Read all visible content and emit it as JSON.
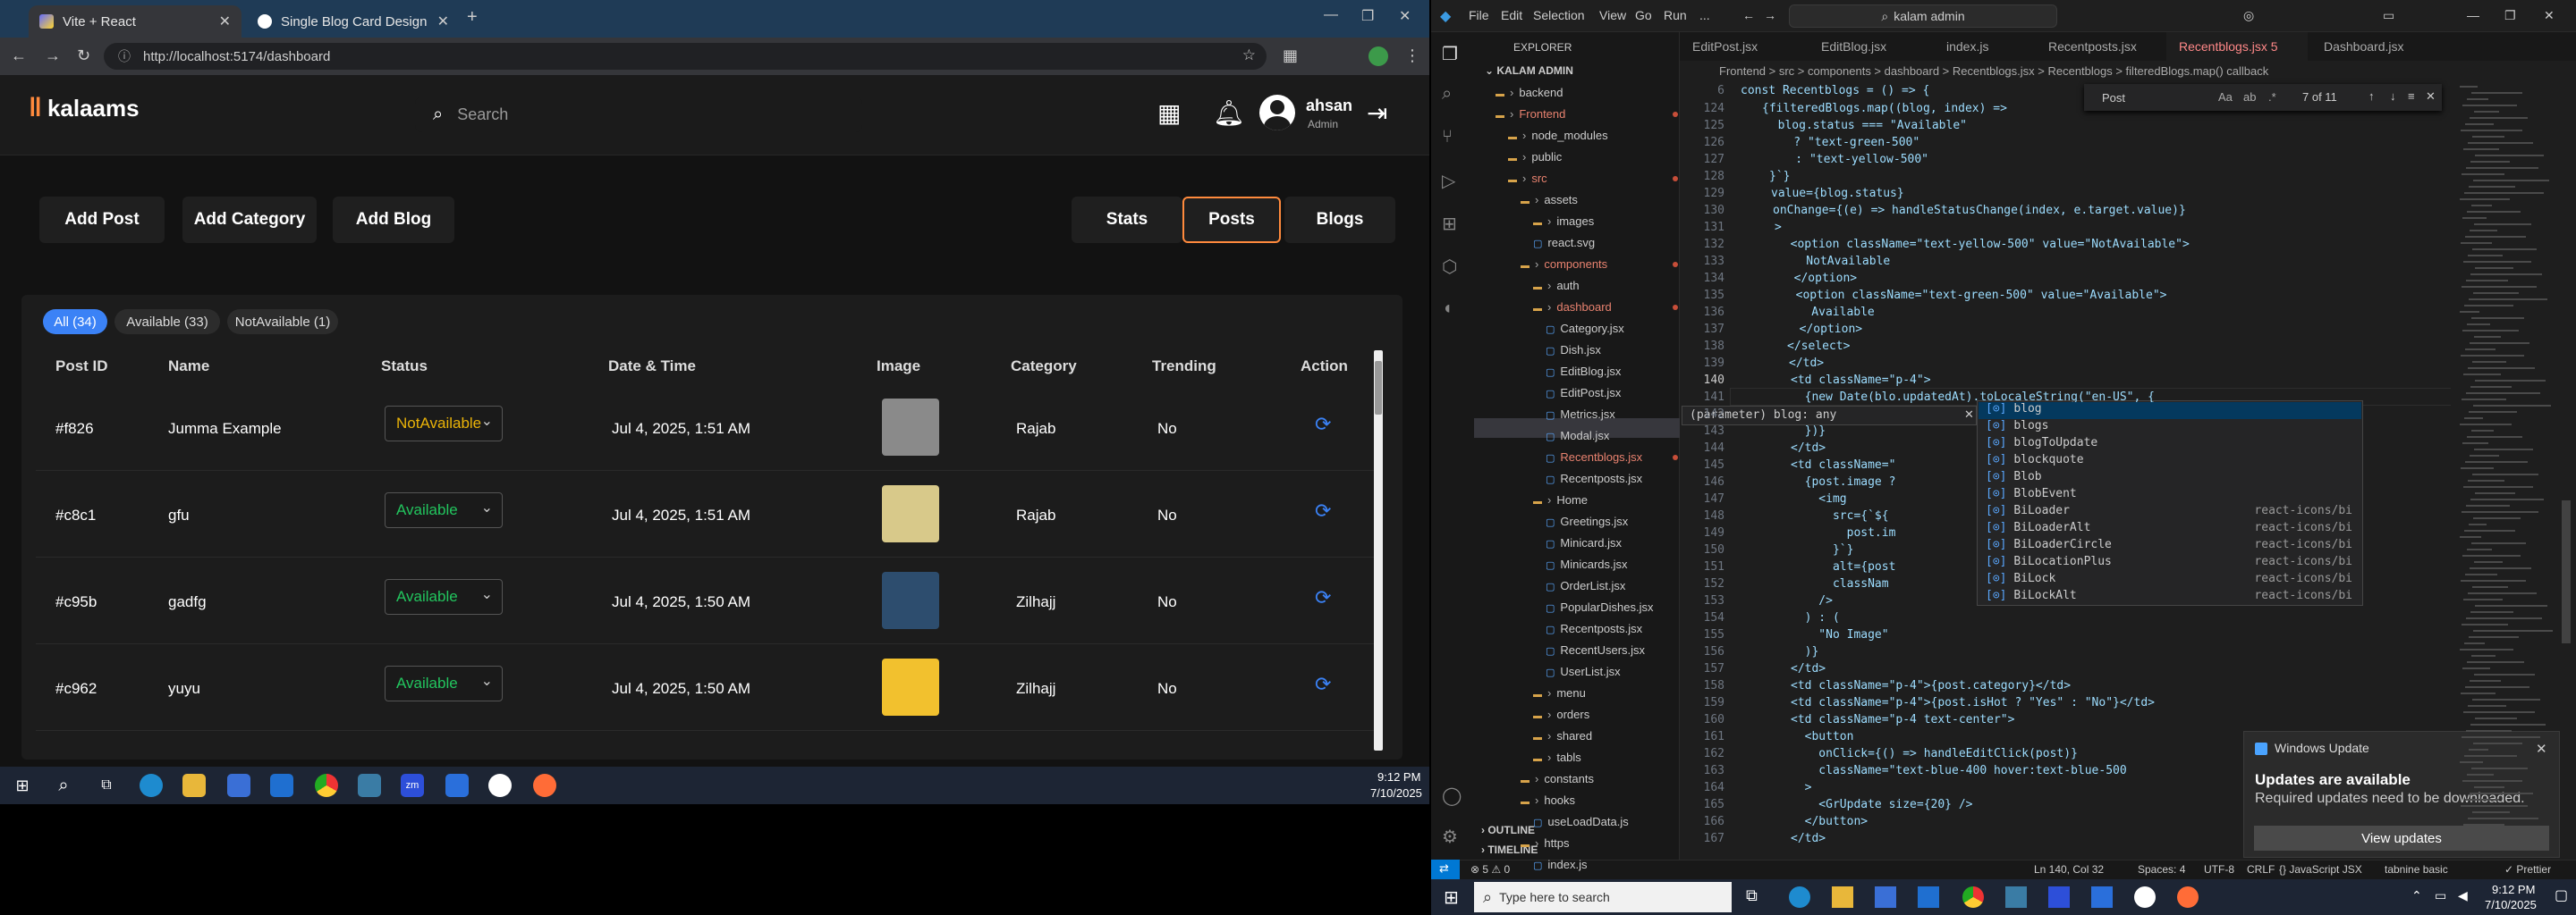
{
  "browser": {
    "tabs": [
      {
        "title": "Vite + React",
        "active": true
      },
      {
        "title": "Single Blog Card Design",
        "active": false
      }
    ],
    "url": "http://localhost:5174/dashboard"
  },
  "app": {
    "logo": "kalaams",
    "search_placeholder": "Search",
    "user": {
      "name": "ahsan",
      "role": "Admin"
    },
    "action_buttons": [
      "Add Post",
      "Add Category",
      "Add Blog"
    ],
    "view_buttons": [
      "Stats",
      "Posts",
      "Blogs"
    ],
    "selected_view": "Posts",
    "filters": [
      "All (34)",
      "Available (33)",
      "NotAvailable (1)"
    ],
    "columns": [
      "Post ID",
      "Name",
      "Status",
      "Date & Time",
      "Image",
      "Category",
      "Trending",
      "Action"
    ],
    "rows": [
      {
        "id": "#f826",
        "name": "Jumma Example",
        "status": "NotAvailable",
        "date": "Jul 4, 2025, 1:51 AM",
        "category": "Rajab",
        "trending": "No",
        "thumb": "#8a8a8a"
      },
      {
        "id": "#c8c1",
        "name": "gfu",
        "status": "Available",
        "date": "Jul 4, 2025, 1:51 AM",
        "category": "Rajab",
        "trending": "No",
        "thumb": "#d8c98a"
      },
      {
        "id": "#c95b",
        "name": "gadfg",
        "status": "Available",
        "date": "Jul 4, 2025, 1:50 AM",
        "category": "Zilhajj",
        "trending": "No",
        "thumb": "#2d4d6e"
      },
      {
        "id": "#c962",
        "name": "yuyu",
        "status": "Available",
        "date": "Jul 4, 2025, 1:50 AM",
        "category": "Zilhajj",
        "trending": "No",
        "thumb": "#f2c12e"
      }
    ]
  },
  "taskbar_left": {
    "time": "9:12 PM",
    "date": "7/10/2025"
  },
  "vscode": {
    "menus": [
      "File",
      "Edit",
      "Selection",
      "View",
      "Go",
      "Run",
      "..."
    ],
    "command_center": "kalam admin",
    "explorer_title": "EXPLORER",
    "root": "KALAM ADMIN",
    "tree": [
      {
        "label": "backend",
        "type": "folder",
        "indent": 1
      },
      {
        "label": "Frontend",
        "type": "folder",
        "indent": 1,
        "accent": true
      },
      {
        "label": "node_modules",
        "type": "folder",
        "indent": 2
      },
      {
        "label": "public",
        "type": "folder",
        "indent": 2
      },
      {
        "label": "src",
        "type": "folder",
        "indent": 2,
        "accent": true
      },
      {
        "label": "assets",
        "type": "folder",
        "indent": 3
      },
      {
        "label": "images",
        "type": "folder",
        "indent": 4
      },
      {
        "label": "react.svg",
        "type": "file",
        "indent": 4
      },
      {
        "label": "components",
        "type": "folder",
        "indent": 3,
        "accent": true
      },
      {
        "label": "auth",
        "type": "folder",
        "indent": 4
      },
      {
        "label": "dashboard",
        "type": "folder",
        "indent": 4,
        "accent": true
      },
      {
        "label": "Category.jsx",
        "type": "file",
        "indent": 5
      },
      {
        "label": "Dish.jsx",
        "type": "file",
        "indent": 5
      },
      {
        "label": "EditBlog.jsx",
        "type": "file",
        "indent": 5
      },
      {
        "label": "EditPost.jsx",
        "type": "file",
        "indent": 5
      },
      {
        "label": "Metrics.jsx",
        "type": "file",
        "indent": 5
      },
      {
        "label": "Modal.jsx",
        "type": "file",
        "indent": 5
      },
      {
        "label": "Recentblogs.jsx",
        "type": "file",
        "indent": 5,
        "accent": true
      },
      {
        "label": "Recentposts.jsx",
        "type": "file",
        "indent": 5
      },
      {
        "label": "Home",
        "type": "folder",
        "indent": 4
      },
      {
        "label": "Greetings.jsx",
        "type": "file",
        "indent": 5
      },
      {
        "label": "Minicard.jsx",
        "type": "file",
        "indent": 5
      },
      {
        "label": "Minicards.jsx",
        "type": "file",
        "indent": 5
      },
      {
        "label": "OrderList.jsx",
        "type": "file",
        "indent": 5
      },
      {
        "label": "PopularDishes.jsx",
        "type": "file",
        "indent": 5
      },
      {
        "label": "Recentposts.jsx",
        "type": "file",
        "indent": 5
      },
      {
        "label": "RecentUsers.jsx",
        "type": "file",
        "indent": 5
      },
      {
        "label": "UserList.jsx",
        "type": "file",
        "indent": 5
      },
      {
        "label": "menu",
        "type": "folder",
        "indent": 4
      },
      {
        "label": "orders",
        "type": "folder",
        "indent": 4
      },
      {
        "label": "shared",
        "type": "folder",
        "indent": 4
      },
      {
        "label": "tabls",
        "type": "folder",
        "indent": 4
      },
      {
        "label": "constants",
        "type": "folder",
        "indent": 3
      },
      {
        "label": "hooks",
        "type": "folder",
        "indent": 3
      },
      {
        "label": "useLoadData.js",
        "type": "file",
        "indent": 4
      },
      {
        "label": "https",
        "type": "folder",
        "indent": 3
      },
      {
        "label": "index.js",
        "type": "file",
        "indent": 4
      }
    ],
    "outline": "OUTLINE",
    "timeline": "TIMELINE",
    "tabs": [
      "EditPost.jsx",
      "EditBlog.jsx",
      "index.js",
      "Recentposts.jsx",
      "Recentblogs.jsx 5",
      "Dashboard.jsx"
    ],
    "active_tab": "Recentblogs.jsx 5",
    "breadcrumbs": "Frontend > src > components > dashboard > Recentblogs.jsx > Recentblogs > filteredBlogs.map() callback",
    "find": {
      "query": "Post",
      "result": "7 of 11"
    },
    "first_line": {
      "num": "6",
      "text": "const Recentblogs = () => {"
    },
    "lines": [
      {
        "n": "124",
        "t": "{filteredBlogs.map((blog, index) =>"
      },
      {
        "n": "125",
        "t": "  blog.status === \"Available\""
      },
      {
        "n": "126",
        "t": "    ? \"text-green-500\""
      },
      {
        "n": "127",
        "t": "    : \"text-yellow-500\""
      },
      {
        "n": "128",
        "t": "}`}"
      },
      {
        "n": "129",
        "t": "value={blog.status}"
      },
      {
        "n": "130",
        "t": "onChange={(e) => handleStatusChange(index, e.target.value)}"
      },
      {
        "n": "131",
        "t": ">"
      },
      {
        "n": "132",
        "t": "  <option className=\"text-yellow-500\" value=\"NotAvailable\">"
      },
      {
        "n": "133",
        "t": "    NotAvailable"
      },
      {
        "n": "134",
        "t": "  </option>"
      },
      {
        "n": "135",
        "t": "  <option className=\"text-green-500\" value=\"Available\">"
      },
      {
        "n": "136",
        "t": "    Available"
      },
      {
        "n": "137",
        "t": "  </option>"
      },
      {
        "n": "138",
        "t": "</select>"
      },
      {
        "n": "139",
        "t": "</td>"
      },
      {
        "n": "140",
        "t": "<td className=\"p-4\">"
      },
      {
        "n": "141",
        "t": "  {new Date(blo.updatedAt).toLocaleString(\"en-US\", {"
      },
      {
        "n": "142",
        "t": ""
      },
      {
        "n": "143",
        "t": "  })}"
      },
      {
        "n": "144",
        "t": "</td>"
      },
      {
        "n": "145",
        "t": "<td className=\""
      },
      {
        "n": "146",
        "t": "  {post.image ?"
      },
      {
        "n": "147",
        "t": "    <img"
      },
      {
        "n": "148",
        "t": "      src={`${"
      },
      {
        "n": "149",
        "t": "        post.im"
      },
      {
        "n": "150",
        "t": "      }`}"
      },
      {
        "n": "151",
        "t": "      alt={post"
      },
      {
        "n": "152",
        "t": "      classNam"
      },
      {
        "n": "153",
        "t": "    />"
      },
      {
        "n": "154",
        "t": "  ) : ("
      },
      {
        "n": "155",
        "t": "    \"No Image\""
      },
      {
        "n": "156",
        "t": "  )}"
      },
      {
        "n": "157",
        "t": "</td>"
      },
      {
        "n": "158",
        "t": "<td className=\"p-4\">{post.category}</td>"
      },
      {
        "n": "159",
        "t": "<td className=\"p-4\">{post.isHot ? \"Yes\" : \"No\"}</td>"
      },
      {
        "n": "160",
        "t": "<td className=\"p-4 text-center\">"
      },
      {
        "n": "161",
        "t": "  <button"
      },
      {
        "n": "162",
        "t": "    onClick={() => handleEditClick(post)}"
      },
      {
        "n": "163",
        "t": "    className=\"text-blue-400 hover:text-blue-500"
      },
      {
        "n": "164",
        "t": "  >"
      },
      {
        "n": "165",
        "t": "    <GrUpdate size={20} />"
      },
      {
        "n": "166",
        "t": "  </button>"
      },
      {
        "n": "167",
        "t": "</td>"
      }
    ],
    "hover_hint": "(parameter) blog: any",
    "suggestions": [
      {
        "label": "blog",
        "src": ""
      },
      {
        "label": "blogs",
        "src": ""
      },
      {
        "label": "blogToUpdate",
        "src": ""
      },
      {
        "label": "blockquote",
        "src": ""
      },
      {
        "label": "Blob",
        "src": ""
      },
      {
        "label": "BlobEvent",
        "src": ""
      },
      {
        "label": "BiLoader",
        "src": "react-icons/bi"
      },
      {
        "label": "BiLoaderAlt",
        "src": "react-icons/bi"
      },
      {
        "label": "BiLoaderCircle",
        "src": "react-icons/bi"
      },
      {
        "label": "BiLocationPlus",
        "src": "react-icons/bi"
      },
      {
        "label": "BiLock",
        "src": "react-icons/bi"
      },
      {
        "label": "BiLockAlt",
        "src": "react-icons/bi"
      }
    ],
    "status": {
      "errors": "⊗ 5 ⚠ 0",
      "cursor": "Ln 140, Col 32",
      "spaces": "Spaces: 4",
      "encoding": "UTF-8",
      "eol": "CRLF",
      "lang": "{} JavaScript JSX",
      "tabnine": "tabnine basic",
      "prettier": "✓ Prettier"
    }
  },
  "notification": {
    "app": "Windows Update",
    "title": "Updates are available",
    "body": "Required updates need to be downloaded.",
    "button": "View updates"
  },
  "taskbar_right": {
    "search_placeholder": "Type here to search",
    "time": "9:12 PM",
    "date": "7/10/2025"
  }
}
